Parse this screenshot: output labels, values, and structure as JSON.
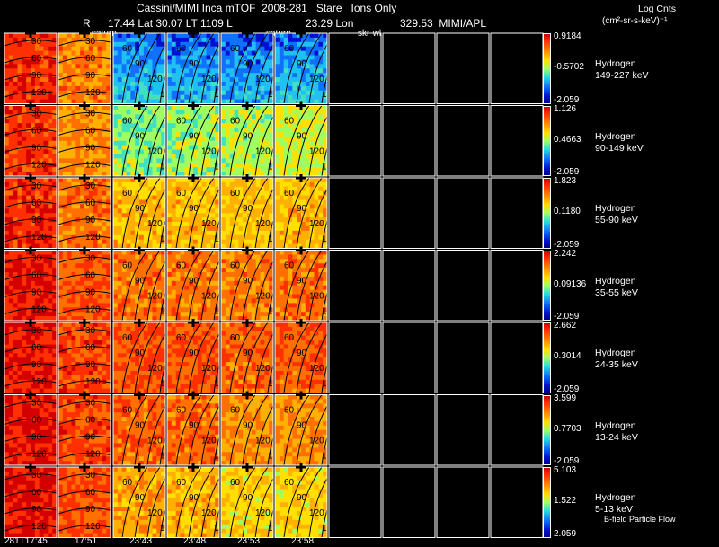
{
  "header": {
    "line1": "Cassini/MIMI Inca mTOF  2008-281   Stare   Ions Only",
    "line2_r": "R",
    "line2": "17.44 Lat 30.07 LT 1109 L",
    "line2_lon": "23.29 Lon",
    "line2_mimi": "329.53  MIMI/APL",
    "units_title": "Log Cnts",
    "units": "(cm²-sr-s-keV)⁻¹",
    "saturn1": "saturn",
    "saturn2": "saturn",
    "skr": "skr-wl"
  },
  "chart_data": {
    "type": "heatmap",
    "rows": [
      {
        "species": "Hydrogen",
        "energy": "149-227 keV",
        "max": "0.9184",
        "mid": "-0.5702",
        "min": "-2.059"
      },
      {
        "species": "Hydrogen",
        "energy": "90-149 keV",
        "max": "1.126",
        "mid": "0.4663",
        "min": "-2.059"
      },
      {
        "species": "Hydrogen",
        "energy": "55-90 keV",
        "max": "1.823",
        "mid": "0.1180",
        "min": "-2.059"
      },
      {
        "species": "Hydrogen",
        "energy": "35-55 keV",
        "max": "2.242",
        "mid": "0.09136",
        "min": "-2.059"
      },
      {
        "species": "Hydrogen",
        "energy": "24-35 keV",
        "max": "2.662",
        "mid": "0.3014",
        "min": "-2.059"
      },
      {
        "species": "Hydrogen",
        "energy": "13-24 keV",
        "max": "3.599",
        "mid": "0.7703",
        "min": "-2.059"
      },
      {
        "species": "Hydrogen",
        "energy": "5-13 keV",
        "max": "5.103",
        "mid": "1.522",
        "min": "2.059"
      }
    ],
    "time_labels": [
      "281T17:45",
      "17:51",
      "23:43",
      "23:48",
      "23:53",
      "23:58"
    ],
    "contour_labels_left": [
      "30",
      "60",
      "90",
      "120"
    ],
    "contour_labels_right": [
      "60",
      "90",
      "120",
      "15"
    ],
    "footnote": "B-field Particle Flow"
  }
}
